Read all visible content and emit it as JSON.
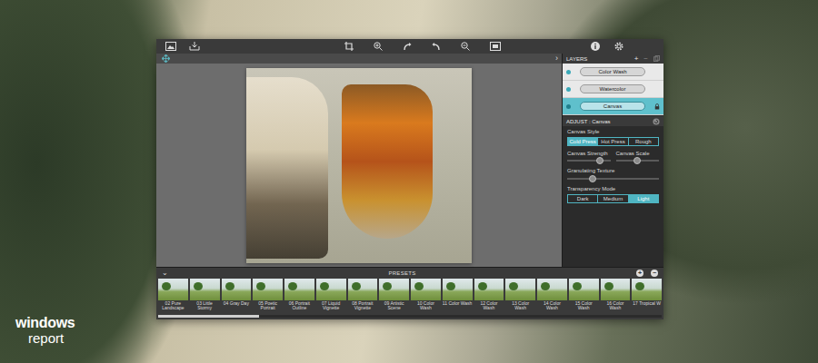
{
  "layers": {
    "title": "LAYERS",
    "add": "+",
    "remove": "−",
    "items": [
      {
        "name": "Color Wash",
        "visible": true,
        "locked": false,
        "selected": false
      },
      {
        "name": "Watercolor",
        "visible": true,
        "locked": false,
        "selected": false
      },
      {
        "name": "Canvas",
        "visible": true,
        "locked": true,
        "selected": true
      }
    ]
  },
  "adjust": {
    "title": "ADJUST : Canvas",
    "canvas_style": {
      "label": "Canvas Style",
      "options": [
        {
          "label": "Cold Press",
          "selected": true
        },
        {
          "label": "Hot Press",
          "selected": false
        },
        {
          "label": "Rough",
          "selected": false
        }
      ]
    },
    "slider_pair": [
      {
        "label": "Canvas Strength",
        "level": 0.75
      },
      {
        "label": "Canvas Scale",
        "level": 0.5
      }
    ],
    "texture": {
      "label": "Granulating Texture",
      "level": 0.28
    },
    "transparency": {
      "label": "Transparency Mode",
      "options": [
        {
          "label": "Dark",
          "selected": false
        },
        {
          "label": "Medium",
          "selected": false
        },
        {
          "label": "Light",
          "selected": true
        }
      ]
    }
  },
  "presets": {
    "title": "PRESETS",
    "add": "+",
    "remove": "−",
    "collapse": "⌄",
    "scroll": {
      "level": 0.2
    },
    "items": [
      {
        "label": "02 Pure Landscape"
      },
      {
        "label": "03 Little Stormy"
      },
      {
        "label": "04 Gray Day"
      },
      {
        "label": "05 Poetic Portrait"
      },
      {
        "label": "06 Portrait Outline"
      },
      {
        "label": "07 Liquid Vignette"
      },
      {
        "label": "08 Portrait Vignette"
      },
      {
        "label": "09 Artistic Scene"
      },
      {
        "label": "10 Color Wash"
      },
      {
        "label": "11 Color Wash"
      },
      {
        "label": "12 Color Wash"
      },
      {
        "label": "13 Color Wash"
      },
      {
        "label": "14 Color Wash"
      },
      {
        "label": "15 Color Wash"
      },
      {
        "label": "16 Color Wash"
      },
      {
        "label": "17 Tropical W"
      }
    ]
  },
  "panel_toggle": "›",
  "logo": {
    "line1": "windows",
    "line2": "report"
  }
}
